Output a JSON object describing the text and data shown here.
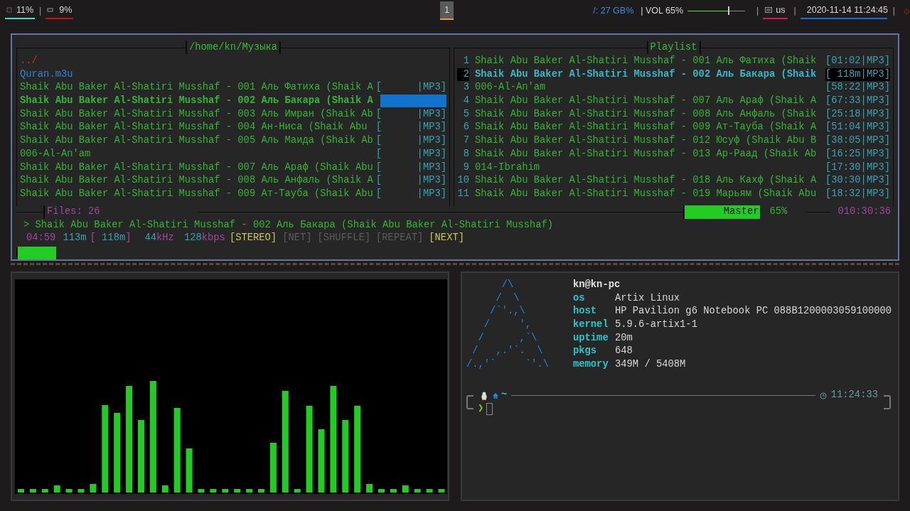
{
  "top_bar": {
    "cpu": "11%",
    "separator": "|",
    "memory": "9%",
    "workspaces": [
      {
        "label": "1",
        "selected": true
      }
    ],
    "disk": "/: 27 GB%",
    "volume": {
      "label": "| VOL 65%",
      "level": 0.7
    },
    "keyboard": "us",
    "clock": "2020-11-14 11:24:45"
  },
  "player": {
    "browser": {
      "title": "/home/kn/Музыка",
      "items": [
        {
          "kind": "parent",
          "name": "../",
          "selected": false
        },
        {
          "kind": "playlist",
          "name": "Quran.m3u",
          "selected": false
        },
        {
          "kind": "track",
          "name": "Shaik Abu Baker Al-Shatiri Musshaf - 001 Аль Фатиха (Shaik A",
          "tag": "[      |MP3]",
          "selected": false
        },
        {
          "kind": "track",
          "name": "Shaik Abu Baker Al-Shatiri Musshaf - 002 Аль Бакара (Shaik A",
          "selected": true
        },
        {
          "kind": "track",
          "name": "Shaik Abu Baker Al-Shatiri Musshaf - 003 Аль Имран (Shaik Ab",
          "tag": "[      |MP3]",
          "selected": false
        },
        {
          "kind": "track",
          "name": "Shaik Abu Baker Al-Shatiri Musshaf - 004 Ан-Ниса (Shaik Abu ",
          "tag": "[      |MP3]",
          "selected": false
        },
        {
          "kind": "track",
          "name": "Shaik Abu Baker Al-Shatiri Musshaf - 005 Аль Маида (Shaik Ab",
          "tag": "[      |MP3]",
          "selected": false
        },
        {
          "kind": "track",
          "name": "006-Al-An'am",
          "tag": "[      |MP3]",
          "selected": false
        },
        {
          "kind": "track",
          "name": "Shaik Abu Baker Al-Shatiri Musshaf - 007 Аль Араф (Shaik Abu",
          "tag": "[      |MP3]",
          "selected": false
        },
        {
          "kind": "track",
          "name": "Shaik Abu Baker Al-Shatiri Musshaf - 008 Аль Анфаль (Shaik A",
          "tag": "[      |MP3]",
          "selected": false
        },
        {
          "kind": "track",
          "name": "Shaik Abu Baker Al-Shatiri Musshaf - 009 Ат-Тауба (Shaik Abu",
          "tag": "[      |MP3]",
          "selected": false
        }
      ]
    },
    "playlist": {
      "title": "Playlist",
      "rows": [
        {
          "number": "1",
          "title": "Shaik Abu Baker Al-Shatiri Musshaf - 001 Аль Фатиха (Shaik",
          "info": "[01:02|MP3]",
          "selected": false
        },
        {
          "number": "2",
          "title": "Shaik Abu Baker Al-Shatiri Musshaf - 002 Аль Бакара (Shaik",
          "info": "[ 118m|MP3]",
          "selected": true
        },
        {
          "number": "3",
          "title": "006-Al-An'am",
          "info": "[58:22|MP3]",
          "selected": false
        },
        {
          "number": "4",
          "title": "Shaik Abu Baker Al-Shatiri Musshaf - 007 Аль Араф (Shaik A",
          "info": "[67:33|MP3]",
          "selected": false
        },
        {
          "number": "5",
          "title": "Shaik Abu Baker Al-Shatiri Musshaf - 008 Аль Анфаль (Shaik",
          "info": "[25:18|MP3]",
          "selected": false
        },
        {
          "number": "6",
          "title": "Shaik Abu Baker Al-Shatiri Musshaf - 009 Ат-Тауба (Shaik A",
          "info": "[51:04|MP3]",
          "selected": false
        },
        {
          "number": "7",
          "title": "Shaik Abu Baker Al-Shatiri Musshaf - 012 Юсуф (Shaik Abu B",
          "info": "[38:05|MP3]",
          "selected": false
        },
        {
          "number": "8",
          "title": "Shaik Abu Baker Al-Shatiri Musshaf - 013 Ар-Раад (Shaik Ab",
          "info": "[16:25|MP3]",
          "selected": false
        },
        {
          "number": "9",
          "title": "014-Ibrahim",
          "info": "[17:30|MP3]",
          "selected": false
        },
        {
          "number": "10",
          "title": "Shaik Abu Baker Al-Shatiri Musshaf - 018 Аль Кахф (Shaik A",
          "info": "[30:30|MP3]",
          "selected": false
        },
        {
          "number": "11",
          "title": "Shaik Abu Baker Al-Shatiri Musshaf - 019 Марьям (Shaik Abu",
          "info": "[18:32|MP3]",
          "selected": false
        }
      ]
    },
    "files": "Files: 26",
    "mixer": {
      "label": "Master",
      "reading": "65%"
    },
    "total_time": "010:30:36",
    "now_playing": "> Shaik Abu Baker Al-Shatiri Musshaf - 002 Аль Бакара (Shaik Abu Baker Al-Shatiri Musshaf)",
    "status": [
      {
        "parts": [
          {
            "text": "04:59",
            "kind": "time"
          }
        ]
      },
      {
        "parts": [
          {
            "text": "113m",
            "kind": "value"
          }
        ]
      },
      {
        "parts": [
          {
            "text": "[",
            "kind": "time"
          },
          {
            "text": " 118m",
            "kind": "value"
          },
          {
            "text": "]",
            "kind": "time"
          }
        ]
      },
      {
        "parts": [
          {
            "text": "44",
            "kind": "value"
          },
          {
            "text": "kHz",
            "kind": "time"
          }
        ]
      },
      {
        "parts": [
          {
            "text": "128",
            "kind": "value"
          },
          {
            "text": "kbps",
            "kind": "time"
          }
        ]
      }
    ],
    "flags": [
      {
        "label": "[STEREO]",
        "on": true
      },
      {
        "label": "[NET]",
        "on": false
      },
      {
        "label": "[SHUFFLE]",
        "on": false
      },
      {
        "label": "[REPEAT]",
        "on": false
      },
      {
        "label": "[NEXT]",
        "on": true
      }
    ],
    "progress": {
      "level": 0.044
    }
  },
  "neofetch": {
    "logo": [
      "      /\\",
      "     /  \\",
      "    /`'.,\\",
      "   /     ',",
      "  /      ,`\\",
      " /   ,.'`.  \\",
      "/.,'`     `'.\\"
    ],
    "user": "kn@kn-pc",
    "info": [
      {
        "key": "os",
        "value": "Artix Linux"
      },
      {
        "key": "host",
        "value": "HP Pavilion g6 Notebook PC 088B1200003059100000"
      },
      {
        "key": "kernel",
        "value": "5.9.6-artix1-1"
      },
      {
        "key": "uptime",
        "value": "20m"
      },
      {
        "key": "pkgs",
        "value": "648"
      },
      {
        "key": "memory",
        "value": "349M / 5408M"
      }
    ],
    "prompt": {
      "directory": "~",
      "time": "11:24:33",
      "symbol": "❯"
    }
  }
}
